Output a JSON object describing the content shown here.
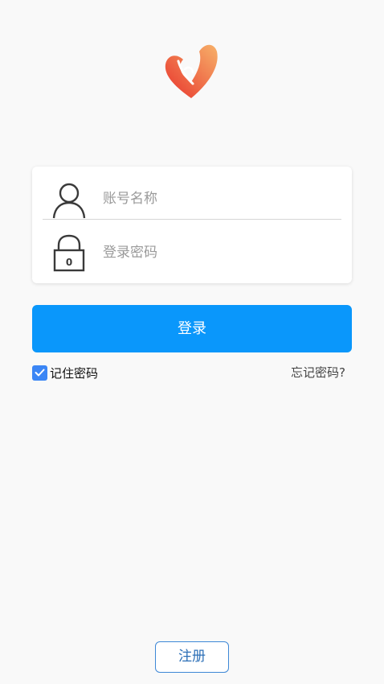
{
  "logo": {
    "icon": "heart-logo-icon",
    "colors": {
      "primary": "#e8332c",
      "secondary": "#f7b26a"
    }
  },
  "form": {
    "username": {
      "placeholder": "账号名称",
      "value": "",
      "icon": "user-icon"
    },
    "password": {
      "placeholder": "登录密码",
      "value": "",
      "icon": "lock-icon",
      "lock_digit": "0"
    }
  },
  "actions": {
    "login_label": "登录",
    "remember_label": "记住密码",
    "remember_checked": true,
    "forgot_label": "忘记密码?",
    "register_label": "注册"
  },
  "colors": {
    "accent": "#0a97fb",
    "checkbox": "#3b86f5",
    "register_border": "#3e88d6",
    "background": "#f9f9f9"
  }
}
